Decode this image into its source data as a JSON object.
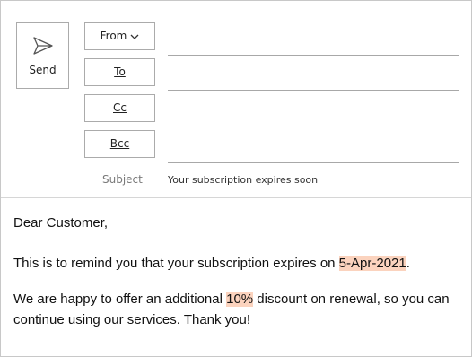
{
  "compose": {
    "send": {
      "label": "Send"
    },
    "from": {
      "label": "From"
    },
    "to": {
      "label": "To",
      "value": ""
    },
    "cc": {
      "label": "Cc",
      "value": ""
    },
    "bcc": {
      "label": "Bcc",
      "value": ""
    },
    "subject": {
      "label": "Subject",
      "value": "Your subscription expires soon"
    }
  },
  "message": {
    "greeting": "Dear Customer,",
    "para1_text": "This is to remind you that your subscription expires on ",
    "para1_date": "5-Apr-2021",
    "para1_end": ".",
    "para2_before": "We are happy to offer an additional ",
    "para2_discount": "10%",
    "para2_after": " discount on renewal, so you can continue using our services. Thank you!"
  },
  "colors": {
    "highlight": "#fbd3be",
    "border": "#ababab"
  },
  "icons": {
    "send": "paper-plane-icon",
    "from_dropdown": "chevron-down-icon"
  }
}
